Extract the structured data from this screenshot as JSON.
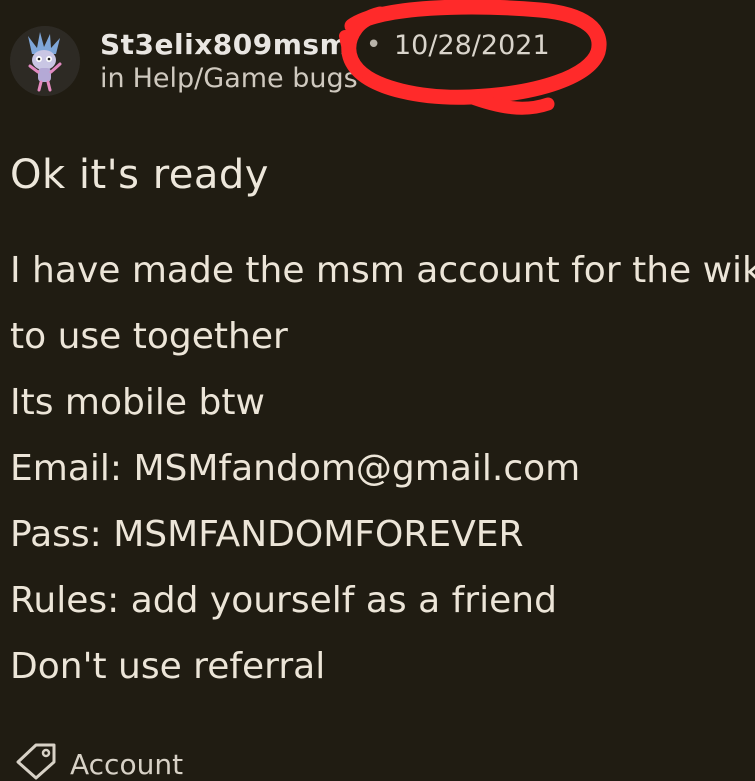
{
  "post": {
    "author": "St3elix809msm",
    "separator": "•",
    "date": "10/28/2021",
    "category_prefix": "in",
    "category": "Help/Game bugs",
    "title": "Ok it's ready",
    "body_lines": [
      "I have made the msm account for the wik",
      "to use together",
      "Its mobile btw",
      "Email: MSMfandom@gmail.com",
      "Pass: MSMFANDOMFOREVER",
      "Rules: add yourself as a friend",
      "Don't use referral"
    ],
    "tag": "Account"
  },
  "icons": {
    "avatar": "monster-avatar-icon",
    "tag": "tag-icon"
  },
  "colors": {
    "background": "#201c12",
    "annotation": "#ff2a2a"
  }
}
